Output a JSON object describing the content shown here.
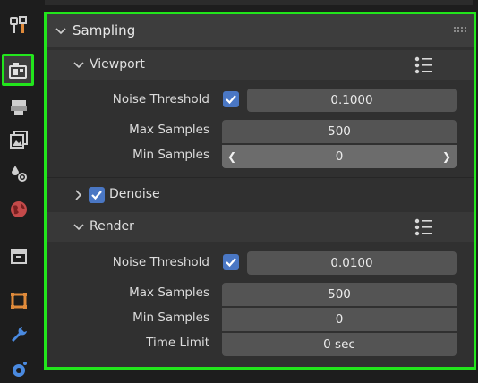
{
  "sidebar": {
    "tabs": [
      {
        "name": "tool-tab",
        "icon": "tool-icon"
      },
      {
        "name": "render-tab",
        "icon": "render-icon",
        "active": true
      },
      {
        "name": "output-tab",
        "icon": "printer-icon"
      },
      {
        "name": "view-layer-tab",
        "icon": "image-icon"
      },
      {
        "name": "scene-tab",
        "icon": "scene-icon"
      },
      {
        "name": "world-tab",
        "icon": "world-icon"
      },
      {
        "name": "collection-tab",
        "icon": "collection-icon"
      },
      {
        "name": "object-tab",
        "icon": "object-icon"
      },
      {
        "name": "modifier-tab",
        "icon": "wrench-icon"
      },
      {
        "name": "particles-tab",
        "icon": "particles-icon"
      }
    ]
  },
  "panel": {
    "title": "Sampling",
    "viewport": {
      "title": "Viewport",
      "noise_threshold_label": "Noise Threshold",
      "noise_threshold_enabled": true,
      "noise_threshold_value": "0.1000",
      "max_samples_label": "Max Samples",
      "max_samples_value": "500",
      "min_samples_label": "Min Samples",
      "min_samples_value": "0"
    },
    "denoise": {
      "label": "Denoise",
      "enabled": true
    },
    "render": {
      "title": "Render",
      "noise_threshold_label": "Noise Threshold",
      "noise_threshold_enabled": true,
      "noise_threshold_value": "0.0100",
      "max_samples_label": "Max Samples",
      "max_samples_value": "500",
      "min_samples_label": "Min Samples",
      "min_samples_value": "0",
      "time_limit_label": "Time Limit",
      "time_limit_value": "0 sec"
    }
  },
  "colors": {
    "highlight": "#22e51c",
    "checkbox": "#4a77c4",
    "field": "#545454",
    "field_hover": "#6c6c6c"
  }
}
